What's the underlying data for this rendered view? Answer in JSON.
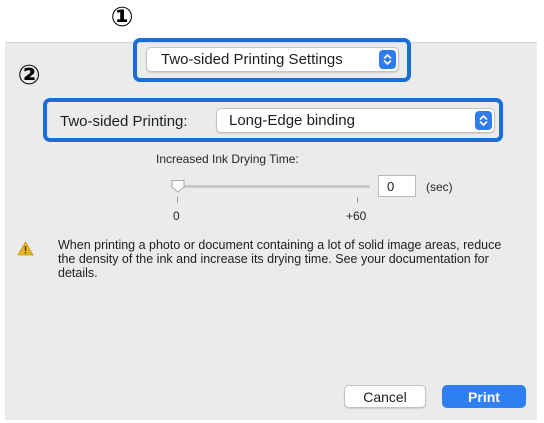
{
  "callouts": {
    "first": "①",
    "second": "②"
  },
  "panel_selector": {
    "value": "Two-sided Printing Settings"
  },
  "two_sided": {
    "label": "Two-sided Printing:",
    "value": "Long-Edge binding"
  },
  "drying_time": {
    "label": "Increased Ink Drying Time:",
    "value": "0",
    "unit": "(sec)",
    "min_label": "0",
    "max_label": "+60",
    "slider_fraction": 0
  },
  "warning": {
    "icon": "warning-icon",
    "text": "When printing a photo or document containing a lot of solid image areas, reduce the density of the ink and increase its drying time. See your documentation for details."
  },
  "buttons": {
    "cancel": "Cancel",
    "print": "Print"
  },
  "colors": {
    "highlight": "#1a6fd6",
    "accent": "#2f7ff2",
    "panel_background": "#ebebeb",
    "warning": "#e6b422"
  }
}
